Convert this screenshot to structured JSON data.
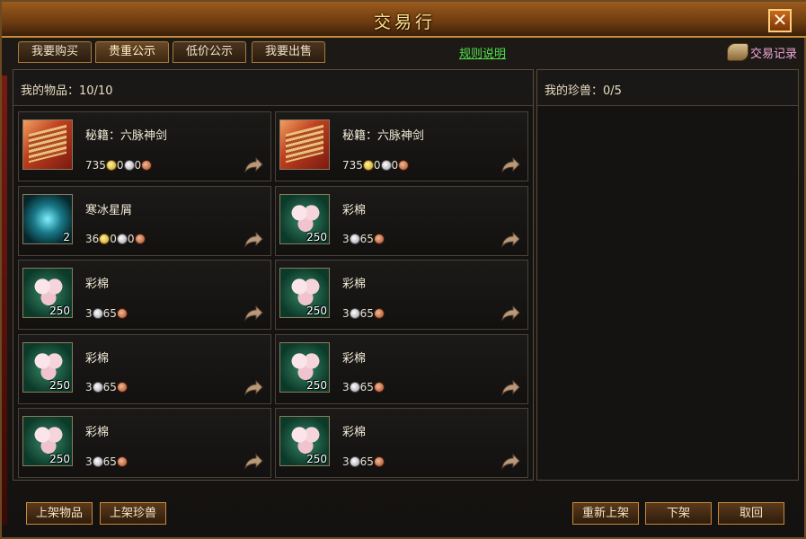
{
  "window": {
    "title": "交易行",
    "close_label": "✕"
  },
  "tabs": [
    {
      "label": "我要购买"
    },
    {
      "label": "贵重公示"
    },
    {
      "label": "低价公示"
    },
    {
      "label": "我要出售"
    }
  ],
  "rules_link": "规则说明",
  "trade_record": {
    "label": "交易记录",
    "icon": "scroll-icon"
  },
  "my_items": {
    "label": "我的物品：",
    "count": "10/10"
  },
  "my_pets": {
    "label": "我的珍兽：",
    "count": "0/5"
  },
  "items": [
    {
      "name": "秘籍：六脉神剑",
      "icon": "book-icon",
      "qty": "",
      "gold": "735",
      "silver": "0",
      "copper": "0"
    },
    {
      "name": "秘籍：六脉神剑",
      "icon": "book-icon",
      "qty": "",
      "gold": "735",
      "silver": "0",
      "copper": "0"
    },
    {
      "name": "寒冰星屑",
      "icon": "ice-shard-icon",
      "qty": "2",
      "gold": "36",
      "silver": "0",
      "copper": "0"
    },
    {
      "name": "彩棉",
      "icon": "cotton-flower-icon",
      "qty": "250",
      "gold": "",
      "silver": "3",
      "copper": "65"
    },
    {
      "name": "彩棉",
      "icon": "cotton-flower-icon",
      "qty": "250",
      "gold": "",
      "silver": "3",
      "copper": "65"
    },
    {
      "name": "彩棉",
      "icon": "cotton-flower-icon",
      "qty": "250",
      "gold": "",
      "silver": "3",
      "copper": "65"
    },
    {
      "name": "彩棉",
      "icon": "cotton-flower-icon",
      "qty": "250",
      "gold": "",
      "silver": "3",
      "copper": "65"
    },
    {
      "name": "彩棉",
      "icon": "cotton-flower-icon",
      "qty": "250",
      "gold": "",
      "silver": "3",
      "copper": "65"
    },
    {
      "name": "彩棉",
      "icon": "cotton-flower-icon",
      "qty": "250",
      "gold": "",
      "silver": "3",
      "copper": "65"
    },
    {
      "name": "彩棉",
      "icon": "cotton-flower-icon",
      "qty": "250",
      "gold": "",
      "silver": "3",
      "copper": "65"
    }
  ],
  "buttons": {
    "list_item": "上架物品",
    "list_pet": "上架珍兽",
    "relist": "重新上架",
    "unlist": "下架",
    "cancel": "取回"
  },
  "colors": {
    "accent": "#c88a3a",
    "title": "#ffe08a",
    "link": "#4fe04a",
    "record": "#f2a9d8"
  }
}
